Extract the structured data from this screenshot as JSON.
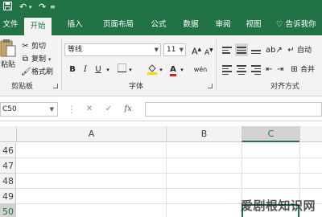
{
  "colors": {
    "brand": "#217346",
    "ribbon_bg": "#f3f3f3",
    "header_bg": "#f3f3f3",
    "selected_header": "#d2d2d2"
  },
  "quick_access": {
    "save_icon": "save-icon",
    "undo_icon": "undo-icon",
    "redo_icon": "redo-icon",
    "customize_icon": "customize-icon"
  },
  "tabs": [
    {
      "label": "文件"
    },
    {
      "label": "开始",
      "active": true
    },
    {
      "label": "插入"
    },
    {
      "label": "页面布局"
    },
    {
      "label": "公式"
    },
    {
      "label": "数据"
    },
    {
      "label": "审阅"
    },
    {
      "label": "视图"
    }
  ],
  "tell_me": "告诉我你",
  "clipboard": {
    "paste": "粘贴",
    "cut": "剪切",
    "copy": "复制",
    "format_painter": "格式刷",
    "group_label": "剪贴板"
  },
  "font": {
    "name": "等线",
    "size": "11",
    "increase": "A",
    "decrease": "A",
    "bold": "B",
    "italic": "I",
    "underline": "U",
    "color_letter": "A",
    "phonetic": "wén",
    "group_label": "字体",
    "color_hex": "#e0201c",
    "fill_hex": "#ffd800"
  },
  "alignment": {
    "wrap": "自动",
    "merge": "合并",
    "group_label": "对齐方式"
  },
  "formula_bar": {
    "name_box": "C50",
    "cancel": "✕",
    "enter": "✓",
    "fx": "fx"
  },
  "columns": [
    "A",
    "B",
    "C"
  ],
  "rows": [
    "46",
    "47",
    "48",
    "49",
    "50"
  ],
  "selected_cell": "C50",
  "watermark": "爱剧根知识网"
}
